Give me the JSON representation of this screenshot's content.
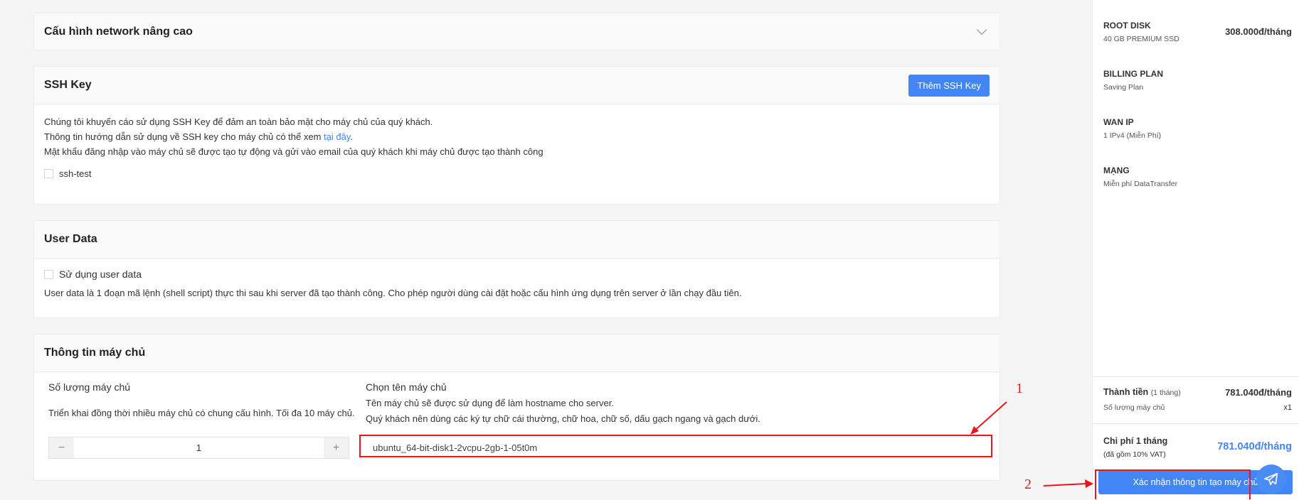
{
  "network": {
    "title": "Cấu hình network nâng cao"
  },
  "ssh": {
    "title": "SSH Key",
    "add_button": "Thêm SSH Key",
    "line1": "Chúng tôi khuyến cáo sử dụng SSH Key để đảm an toàn bảo mật cho máy chủ của quý khách.",
    "line2_prefix": "Thông tin hướng dẫn sử dụng về SSH key cho máy chủ có thể xem ",
    "line2_link": "tại đây",
    "line2_suffix": ".",
    "line3": "Mật khẩu đăng nhập vào máy chủ sẽ được tạo tự động và gửi vào email của quý khách khi máy chủ được tạo thành công",
    "key_name": "ssh-test"
  },
  "userdata": {
    "title": "User Data",
    "checkbox_label": "Sử dụng user data",
    "description": "User data là 1 đoạn mã lệnh (shell script) thực thi sau khi server đã tạo thành công. Cho phép người dùng cài đặt hoặc cấu hình ứng dụng trên server ở lần chạy đầu tiên."
  },
  "server_info": {
    "title": "Thông tin máy chủ",
    "quantity_label": "Số lượng máy chủ",
    "quantity_help": "Triển khai đồng thời nhiều máy chủ có chung cấu hình. Tối đa 10 máy chủ.",
    "quantity_value": "1",
    "minus": "−",
    "plus": "+",
    "name_label": "Chọn tên máy chủ",
    "name_help1": "Tên máy chủ sẽ được sử dụng để làm hostname cho server.",
    "name_help2": "Quý khách nên dùng các ký tự chữ cái thường, chữ hoa, chữ số, dấu gạch ngang và gạch dưới.",
    "name_value": "ubuntu_64-bit-disk1-2vcpu-2gb-1-05t0m"
  },
  "sidebar": {
    "root_disk": {
      "label": "ROOT DISK",
      "value": "40 GB PREMIUM SSD",
      "price": "308.000đ/tháng"
    },
    "billing": {
      "label": "BILLING PLAN",
      "value": "Saving Plan"
    },
    "wan": {
      "label": "WAN IP",
      "value": "1 IPv4 (Miễn Phí)"
    },
    "network": {
      "label": "MẠNG",
      "value": "Miễn phí DataTransfer"
    },
    "total_label": "Thành tiền",
    "total_period": "(1 tháng)",
    "total_price": "781.040đ/tháng",
    "qty_label": "Số lượng máy chủ",
    "qty_value": "x1",
    "monthly_label": "Chi phí 1 tháng",
    "monthly_vat": "(đã gồm 10% VAT)",
    "monthly_price": "781.040đ/tháng",
    "confirm_button": "Xác nhận thông tin tạo máy chủ"
  },
  "annotations": {
    "one": "1",
    "two": "2"
  },
  "colors": {
    "accent": "#4285f4",
    "annotation": "#e8151b"
  }
}
